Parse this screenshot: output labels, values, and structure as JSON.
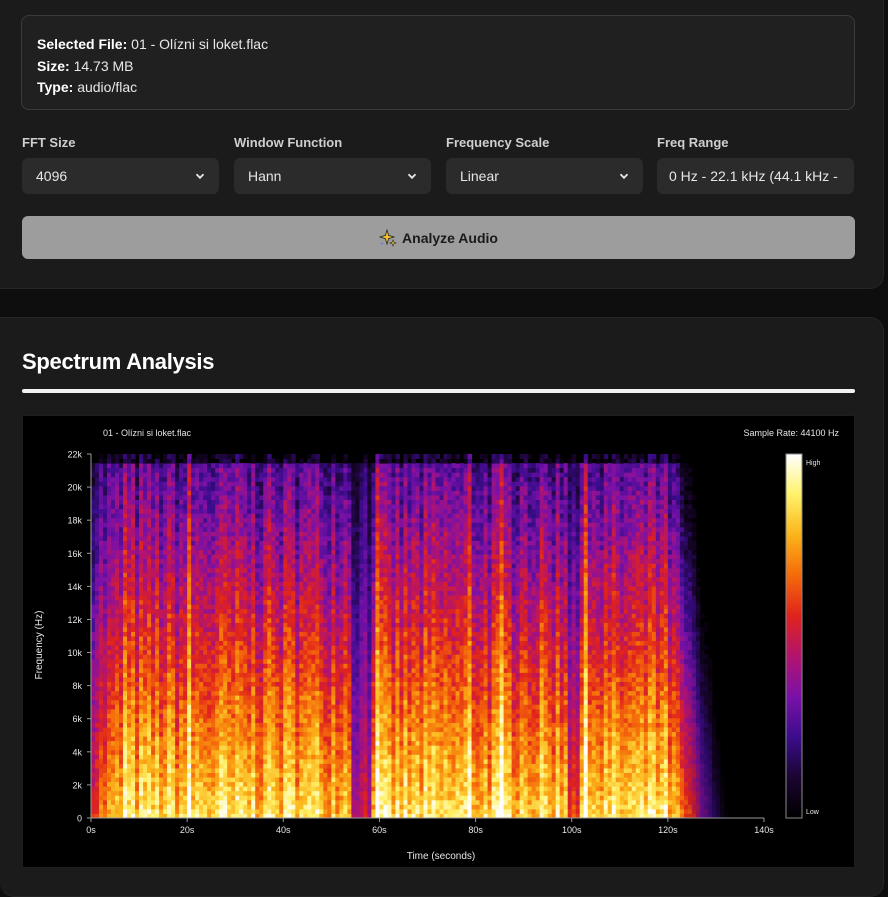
{
  "file_info": {
    "selected_label": "Selected File:",
    "selected_value": "01 - Olízni si loket.flac",
    "size_label": "Size:",
    "size_value": "14.73 MB",
    "type_label": "Type:",
    "type_value": "audio/flac"
  },
  "controls": {
    "fft_size": {
      "label": "FFT Size",
      "value": "4096"
    },
    "window_function": {
      "label": "Window Function",
      "value": "Hann"
    },
    "frequency_scale": {
      "label": "Frequency Scale",
      "value": "Linear"
    },
    "freq_range": {
      "label": "Freq Range",
      "value": "0 Hz - 22.1 kHz (44.1 kHz - "
    }
  },
  "analyze_button": {
    "label": "Analyze Audio",
    "icon": "sparkle-icon"
  },
  "spectrum": {
    "heading": "Spectrum Analysis",
    "file_name": "01 - Olízni si loket.flac",
    "sample_rate": "Sample Rate: 44100 Hz",
    "x_label": "Time (seconds)",
    "y_label": "Frequency (Hz)",
    "legend_high": "High",
    "legend_low": "Low",
    "x_ticks": [
      "0s",
      "20s",
      "40s",
      "60s",
      "80s",
      "100s",
      "120s",
      "140s"
    ],
    "y_ticks": [
      "0",
      "2k",
      "4k",
      "6k",
      "8k",
      "10k",
      "12k",
      "14k",
      "16k",
      "18k",
      "20k",
      "22k"
    ],
    "x_max_seconds": 140,
    "y_max_hz": 22000,
    "audio_end_seconds": 133,
    "colormap": [
      "#000000",
      "#1a0530",
      "#3b0c8c",
      "#7a11a8",
      "#b3136e",
      "#e0231c",
      "#f56a0a",
      "#fbb41a",
      "#fff26a",
      "#ffffff"
    ]
  }
}
